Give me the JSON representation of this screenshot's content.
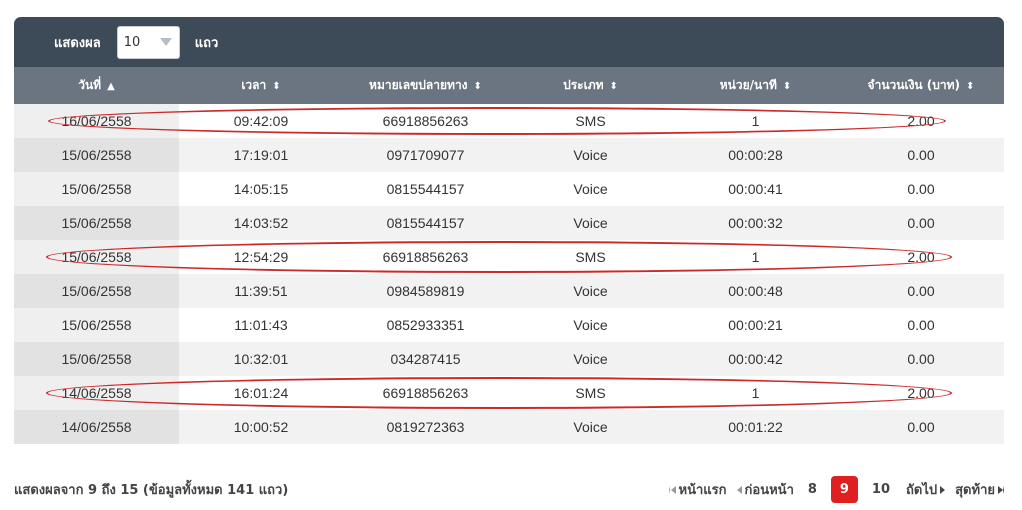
{
  "toolbar": {
    "show_label": "แสดงผล",
    "page_size": "10",
    "rows_label": "แถว"
  },
  "table": {
    "headers": [
      {
        "label": "วันที่",
        "sort": "▲"
      },
      {
        "label": "เวลา",
        "sort": "⬍"
      },
      {
        "label": "หมายเลขปลายทาง",
        "sort": "⬍"
      },
      {
        "label": "ประเภท",
        "sort": "⬍"
      },
      {
        "label": "หน่วย/นาที",
        "sort": "⬍"
      },
      {
        "label": "จำนวนเงิน (บาท)",
        "sort": "⬍"
      }
    ],
    "rows": [
      {
        "date": "16/06/2558",
        "time": "09:42:09",
        "number": "66918856263",
        "type": "SMS",
        "unit": "1",
        "amount": "2.00"
      },
      {
        "date": "15/06/2558",
        "time": "17:19:01",
        "number": "0971709077",
        "type": "Voice",
        "unit": "00:00:28",
        "amount": "0.00"
      },
      {
        "date": "15/06/2558",
        "time": "14:05:15",
        "number": "0815544157",
        "type": "Voice",
        "unit": "00:00:41",
        "amount": "0.00"
      },
      {
        "date": "15/06/2558",
        "time": "14:03:52",
        "number": "0815544157",
        "type": "Voice",
        "unit": "00:00:32",
        "amount": "0.00"
      },
      {
        "date": "15/06/2558",
        "time": "12:54:29",
        "number": "66918856263",
        "type": "SMS",
        "unit": "1",
        "amount": "2.00"
      },
      {
        "date": "15/06/2558",
        "time": "11:39:51",
        "number": "0984589819",
        "type": "Voice",
        "unit": "00:00:48",
        "amount": "0.00"
      },
      {
        "date": "15/06/2558",
        "time": "11:01:43",
        "number": "0852933351",
        "type": "Voice",
        "unit": "00:00:21",
        "amount": "0.00"
      },
      {
        "date": "15/06/2558",
        "time": "10:32:01",
        "number": "034287415",
        "type": "Voice",
        "unit": "00:00:42",
        "amount": "0.00"
      },
      {
        "date": "14/06/2558",
        "time": "16:01:24",
        "number": "66918856263",
        "type": "SMS",
        "unit": "1",
        "amount": "2.00"
      },
      {
        "date": "14/06/2558",
        "time": "10:00:52",
        "number": "0819272363",
        "type": "Voice",
        "unit": "00:01:22",
        "amount": "0.00"
      }
    ]
  },
  "footer": {
    "info": "แสดงผลจาก 9 ถึง 15 (ข้อมูลทั้งหมด 141 แถว)",
    "first": "หน้าแรก",
    "prev": "ก่อนหน้า",
    "pages": [
      "8",
      "9",
      "10"
    ],
    "current_page": "9",
    "next": "ถัดไป",
    "last": "สุดท้าย"
  },
  "colors": {
    "header_dark": "#3d4a58",
    "header_columns": "#6b7581",
    "highlight_oval": "#cc2a2a",
    "current_page": "#e02020"
  }
}
